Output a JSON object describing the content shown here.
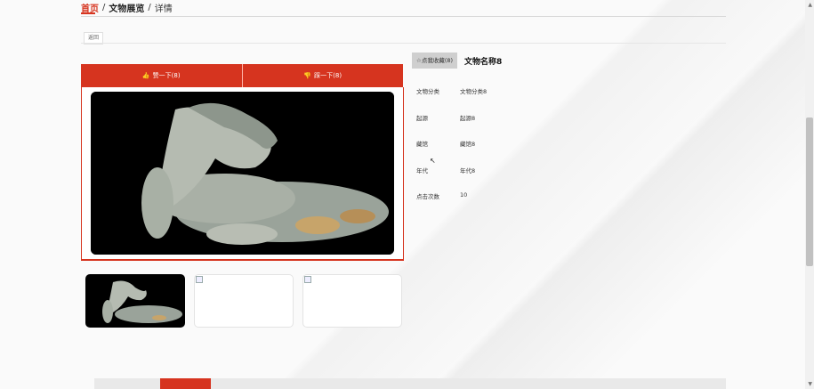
{
  "breadcrumb": {
    "home": "首页",
    "sep1": "/",
    "list": "文物展览",
    "sep2": "/",
    "detail": "详情"
  },
  "back_button": "返回",
  "vote": {
    "like": "赞一下(8)",
    "dislike": "踩一下(8)"
  },
  "favorite_button": "☆点我收藏(8)",
  "item": {
    "title": "文物名称8",
    "fields": [
      {
        "label": "文物分类",
        "value": "文物分类8"
      },
      {
        "label": "起源",
        "value": "起源8"
      },
      {
        "label": "藏馆",
        "value": "藏馆8"
      },
      {
        "label": "年代",
        "value": "年代8"
      },
      {
        "label": "点击次数",
        "value": "10"
      }
    ]
  },
  "colors": {
    "accent": "#d6341f"
  },
  "icons": {
    "like": "thumbs-up-icon",
    "dislike": "thumbs-down-icon",
    "favorite": "star-icon"
  }
}
